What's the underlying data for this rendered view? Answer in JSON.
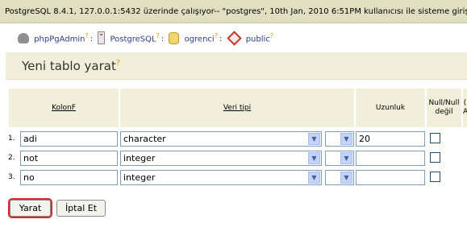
{
  "status_bar": {
    "text": "PostgreSQL 8.4.1, 127.0.0.1:5432 üzerinde çalışıyor-- \"postgres\", 10th Jan, 2010 6:51PM kullanıcısı ile sisteme giriş yap"
  },
  "breadcrumb": {
    "items": [
      {
        "label": "phpPgAdmin",
        "icon": "elephant-icon"
      },
      {
        "label": "PostgreSQL",
        "icon": "server-icon"
      },
      {
        "label": "ogrenci",
        "icon": "database-icon"
      },
      {
        "label": "public",
        "icon": "schema-icon"
      }
    ],
    "separator": ":",
    "help_mark": "?"
  },
  "page": {
    "title": "Yeni tablo yarat",
    "help_mark": "?"
  },
  "table": {
    "headers": {
      "column": "KolonF",
      "type": "Veri tipi",
      "length": "Uzunluk",
      "not_null": "Null/Null değil",
      "extra": "(\nA"
    },
    "rows": [
      {
        "num": "1.",
        "name": "adi",
        "type": "character",
        "length": "20",
        "not_null": false
      },
      {
        "num": "2.",
        "name": "not",
        "type": "integer",
        "length": "",
        "not_null": false
      },
      {
        "num": "3.",
        "name": "no",
        "type": "integer",
        "length": "",
        "not_null": false
      }
    ]
  },
  "actions": {
    "create": "Yarat",
    "cancel": "İptal Et"
  },
  "colors": {
    "accent_border": "#d7282f",
    "header_bg": "#f1efd9",
    "topbar_bg": "#e0dfc2"
  }
}
